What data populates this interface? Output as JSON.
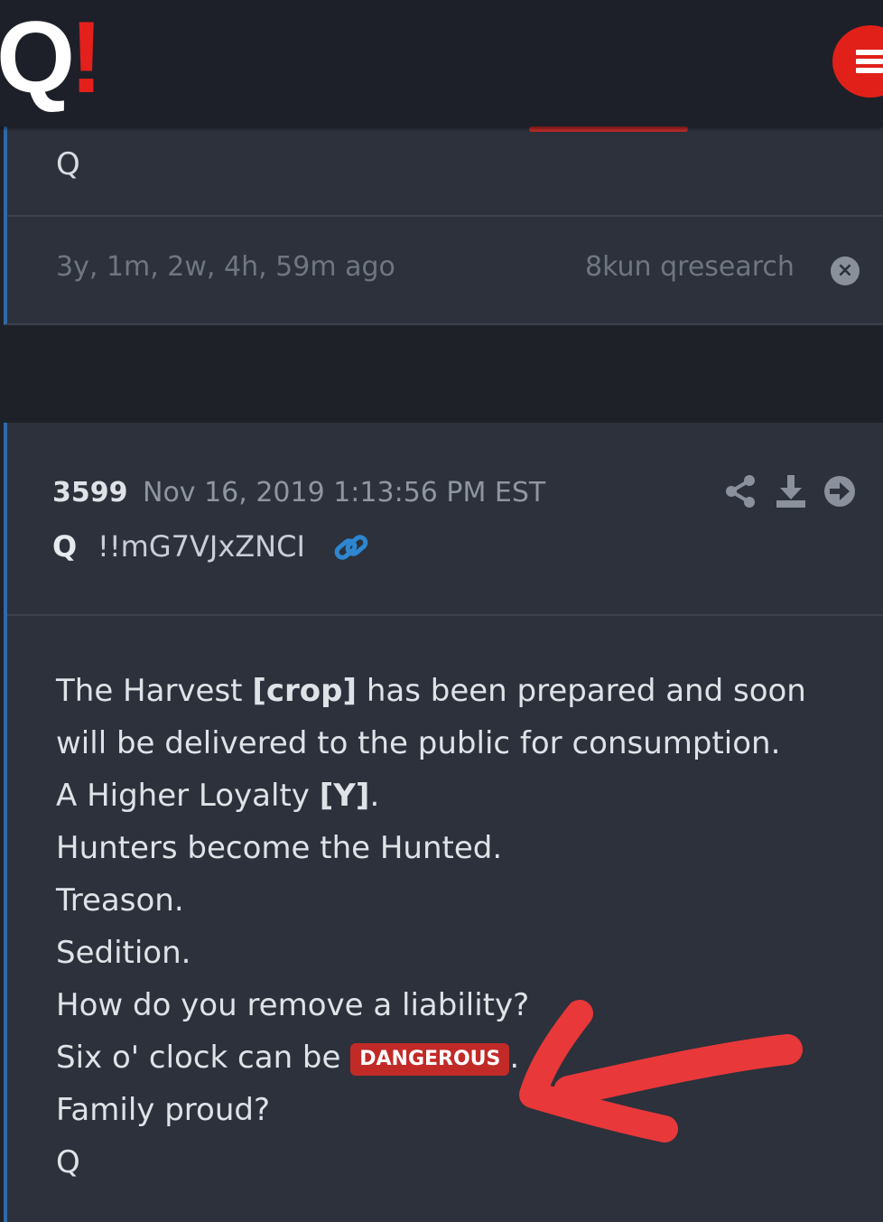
{
  "header": {
    "logo_q": "Q",
    "logo_bang": "!",
    "menu_icon": "menu-icon",
    "accent": "#e3201c"
  },
  "previous_post": {
    "signature": "Q",
    "age": "3y, 1m, 2w, 4h, 59m ago",
    "source": "8kun qresearch",
    "close_icon": "close-circle-icon"
  },
  "post": {
    "number": "3599",
    "date": "Nov 16, 2019 1:13:56 PM EST",
    "author": "Q",
    "tripcode": "!!mG7VJxZNCI",
    "icons": [
      "share-icon",
      "download-icon",
      "go-arrow-icon",
      "link-icon"
    ],
    "lines": {
      "l1_a": "The Harvest ",
      "l1_b": "[crop]",
      "l1_c": " has been prepared and soon",
      "l2": "will be delivered to the public for consumption.",
      "l3_a": "A Higher Loyalty ",
      "l3_b": "[Y]",
      "l3_c": ".",
      "l4": "Hunters become the Hunted.",
      "l5": "Treason.",
      "l6": "Sedition.",
      "l7": "How do you remove a liability?",
      "l8_a": "Six o' clock can be ",
      "l8_badge": "DANGEROUS",
      "l8_c": ".",
      "l9": "Family proud?",
      "l10": "Q"
    }
  },
  "colors": {
    "page_bg": "#1e2128",
    "card_bg": "#2c313b",
    "card_accent": "#2f6aa8",
    "badge": "#c22a28",
    "annotation_arrow": "#e8383a"
  }
}
